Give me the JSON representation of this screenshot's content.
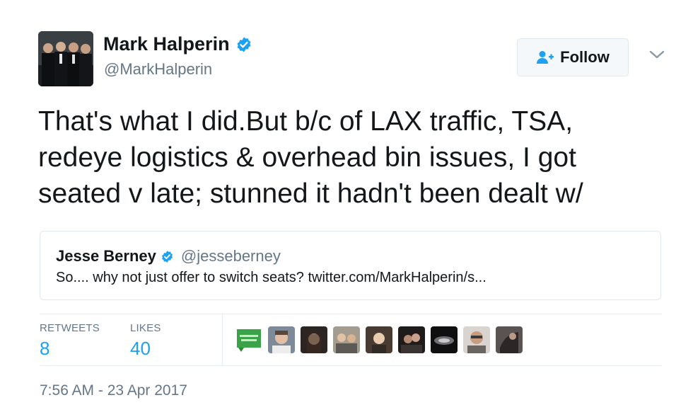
{
  "author": {
    "name": "Mark Halperin",
    "handle": "@MarkHalperin",
    "verified": true
  },
  "follow_button": {
    "label": "Follow"
  },
  "tweet": {
    "text_lines": [
      "That's what I did.But b/c of LAX traffic, TSA,",
      "redeye logistics & overhead bin issues, I got",
      "seated v late; stunned it hadn't been dealt w/"
    ]
  },
  "quoted_tweet": {
    "name": "Jesse Berney",
    "handle": "@jesseberney",
    "verified": true,
    "text": "So.... why not just offer to switch seats? twitter.com/MarkHalperin/s..."
  },
  "stats": {
    "retweets_label": "RETWEETS",
    "retweets_value": "8",
    "likes_label": "LIKES",
    "likes_value": "40"
  },
  "liker_avatars": [
    "avatar-green-badge",
    "avatar-man-smiling",
    "avatar-woman-dark-hair",
    "avatar-group-photo",
    "avatar-woman-portrait",
    "avatar-couple",
    "avatar-dark-abstract",
    "avatar-man-glasses",
    "avatar-hand-photo"
  ],
  "timestamp": "7:56 AM - 23 Apr 2017",
  "colors": {
    "accent": "#1da1f2",
    "secondary_text": "#657786",
    "border": "#e1e8ed"
  }
}
